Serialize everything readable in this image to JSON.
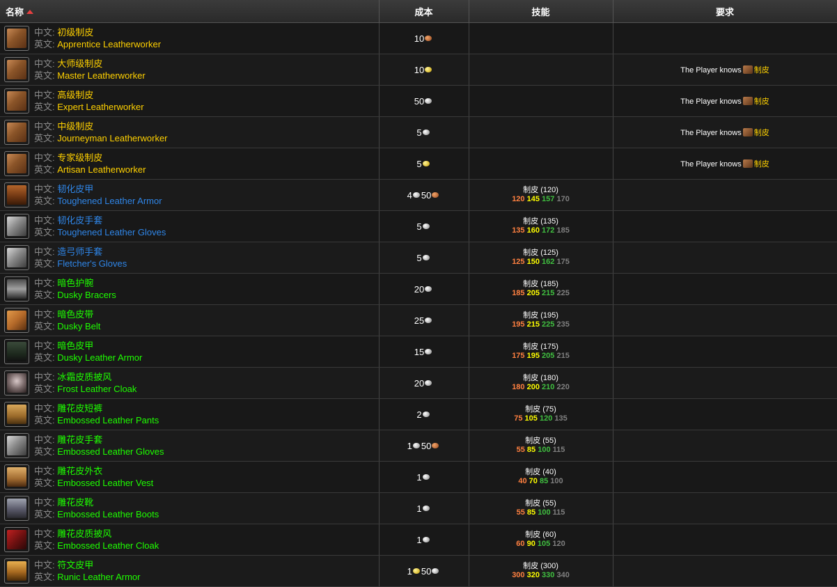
{
  "header": {
    "name": "名称",
    "cost": "成本",
    "skill": "技能",
    "req": "要求"
  },
  "labels": {
    "zh": "中文:",
    "en": "英文:"
  },
  "rows": [
    {
      "icon": "leather-bag-icon",
      "zh": "初级制皮",
      "en": "Apprentice Leatherworker",
      "color": "orange",
      "cost": [
        {
          "n": "10",
          "t": "copper"
        }
      ],
      "skill": null,
      "req": null
    },
    {
      "icon": "leather-bag-icon",
      "zh": "大师级制皮",
      "en": "Master Leatherworker",
      "color": "orange",
      "cost": [
        {
          "n": "10",
          "t": "gold"
        }
      ],
      "skill": null,
      "req": {
        "text": "The Player knows",
        "prof": "制皮"
      }
    },
    {
      "icon": "leather-bag-icon",
      "zh": "高级制皮",
      "en": "Expert Leatherworker",
      "color": "orange",
      "cost": [
        {
          "n": "50",
          "t": "silver"
        }
      ],
      "skill": null,
      "req": {
        "text": "The Player knows",
        "prof": "制皮"
      }
    },
    {
      "icon": "leather-bag-icon",
      "zh": "中级制皮",
      "en": "Journeyman Leatherworker",
      "color": "orange",
      "cost": [
        {
          "n": "5",
          "t": "silver"
        }
      ],
      "skill": null,
      "req": {
        "text": "The Player knows",
        "prof": "制皮"
      }
    },
    {
      "icon": "leather-bag-icon",
      "zh": "专家级制皮",
      "en": "Artisan Leatherworker",
      "color": "orange",
      "cost": [
        {
          "n": "5",
          "t": "gold"
        }
      ],
      "skill": null,
      "req": {
        "text": "The Player knows",
        "prof": "制皮"
      }
    },
    {
      "icon": "chest-armor-icon",
      "zh": "韧化皮甲",
      "en": "Toughened Leather Armor",
      "color": "blue",
      "cost": [
        {
          "n": "4",
          "t": "silver"
        },
        {
          "n": "50",
          "t": "copper"
        }
      ],
      "skill": {
        "name": "制皮",
        "level": "(120)",
        "v": [
          "120",
          "145",
          "157",
          "170"
        ]
      },
      "req": null
    },
    {
      "icon": "gloves-icon",
      "zh": "韧化皮手套",
      "en": "Toughened Leather Gloves",
      "color": "blue",
      "cost": [
        {
          "n": "5",
          "t": "silver"
        }
      ],
      "skill": {
        "name": "制皮",
        "level": "(135)",
        "v": [
          "135",
          "160",
          "172",
          "185"
        ]
      },
      "req": null
    },
    {
      "icon": "gloves-icon",
      "zh": "造弓师手套",
      "en": "Fletcher's Gloves",
      "color": "blue",
      "cost": [
        {
          "n": "5",
          "t": "silver"
        }
      ],
      "skill": {
        "name": "制皮",
        "level": "(125)",
        "v": [
          "125",
          "150",
          "162",
          "175"
        ]
      },
      "req": null
    },
    {
      "icon": "bracers-icon",
      "zh": "暗色护腕",
      "en": "Dusky Bracers",
      "color": "green",
      "cost": [
        {
          "n": "20",
          "t": "silver"
        }
      ],
      "skill": {
        "name": "制皮",
        "level": "(185)",
        "v": [
          "185",
          "205",
          "215",
          "225"
        ]
      },
      "req": null
    },
    {
      "icon": "belt-icon",
      "zh": "暗色皮带",
      "en": "Dusky Belt",
      "color": "green",
      "cost": [
        {
          "n": "25",
          "t": "silver"
        }
      ],
      "skill": {
        "name": "制皮",
        "level": "(195)",
        "v": [
          "195",
          "215",
          "225",
          "235"
        ]
      },
      "req": null
    },
    {
      "icon": "dark-armor-icon",
      "zh": "暗色皮甲",
      "en": "Dusky Leather Armor",
      "color": "green",
      "cost": [
        {
          "n": "15",
          "t": "silver"
        }
      ],
      "skill": {
        "name": "制皮",
        "level": "(175)",
        "v": [
          "175",
          "195",
          "205",
          "215"
        ]
      },
      "req": null
    },
    {
      "icon": "cloak-icon",
      "zh": "冰霜皮质披风",
      "en": "Frost Leather Cloak",
      "color": "green",
      "cost": [
        {
          "n": "20",
          "t": "silver"
        }
      ],
      "skill": {
        "name": "制皮",
        "level": "(180)",
        "v": [
          "180",
          "200",
          "210",
          "220"
        ]
      },
      "req": null
    },
    {
      "icon": "pants-icon",
      "zh": "雕花皮短裤",
      "en": "Embossed Leather Pants",
      "color": "green",
      "cost": [
        {
          "n": "2",
          "t": "silver"
        }
      ],
      "skill": {
        "name": "制皮",
        "level": "(75)",
        "v": [
          "75",
          "105",
          "120",
          "135"
        ]
      },
      "req": null
    },
    {
      "icon": "gloves-icon",
      "zh": "雕花皮手套",
      "en": "Embossed Leather Gloves",
      "color": "green",
      "cost": [
        {
          "n": "1",
          "t": "silver"
        },
        {
          "n": "50",
          "t": "copper"
        }
      ],
      "skill": {
        "name": "制皮",
        "level": "(55)",
        "v": [
          "55",
          "85",
          "100",
          "115"
        ]
      },
      "req": null
    },
    {
      "icon": "vest-icon",
      "zh": "雕花皮外衣",
      "en": "Embossed Leather Vest",
      "color": "green",
      "cost": [
        {
          "n": "1",
          "t": "silver"
        }
      ],
      "skill": {
        "name": "制皮",
        "level": "(40)",
        "v": [
          "40",
          "70",
          "85",
          "100"
        ]
      },
      "req": null
    },
    {
      "icon": "boots-icon",
      "zh": "雕花皮靴",
      "en": "Embossed Leather Boots",
      "color": "green",
      "cost": [
        {
          "n": "1",
          "t": "silver"
        }
      ],
      "skill": {
        "name": "制皮",
        "level": "(55)",
        "v": [
          "55",
          "85",
          "100",
          "115"
        ]
      },
      "req": null
    },
    {
      "icon": "red-cloak-icon",
      "zh": "雕花皮质披风",
      "en": "Embossed Leather Cloak",
      "color": "green",
      "cost": [
        {
          "n": "1",
          "t": "silver"
        }
      ],
      "skill": {
        "name": "制皮",
        "level": "(60)",
        "v": [
          "60",
          "90",
          "105",
          "120"
        ]
      },
      "req": null
    },
    {
      "icon": "runic-armor-icon",
      "zh": "符文皮甲",
      "en": "Runic Leather Armor",
      "color": "green",
      "cost": [
        {
          "n": "1",
          "t": "gold"
        },
        {
          "n": "50",
          "t": "silver"
        }
      ],
      "skill": {
        "name": "制皮",
        "level": "(300)",
        "v": [
          "300",
          "320",
          "330",
          "340"
        ]
      },
      "req": null
    }
  ]
}
